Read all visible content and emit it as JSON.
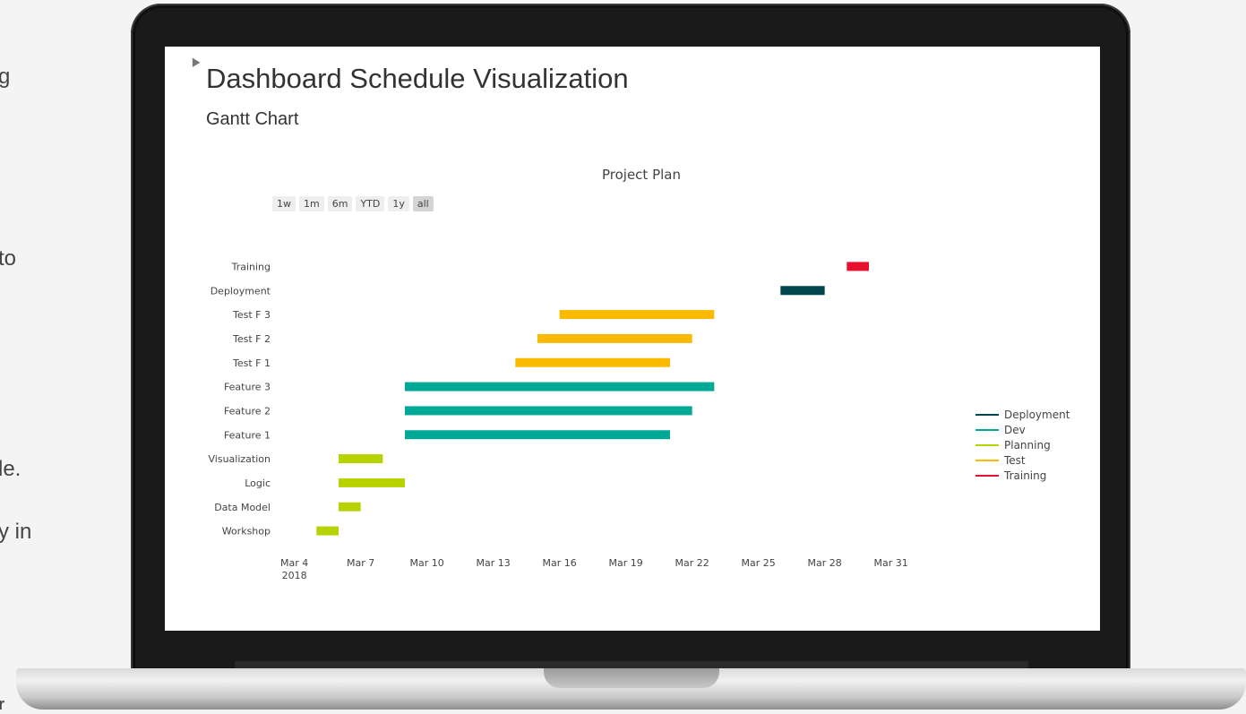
{
  "side_text": [
    "g",
    "to",
    "le.",
    "y in",
    "r"
  ],
  "page": {
    "title": "Dashboard Schedule Visualization",
    "subtitle": "Gantt Chart"
  },
  "range_buttons": [
    {
      "label": "1w",
      "active": false
    },
    {
      "label": "1m",
      "active": false
    },
    {
      "label": "6m",
      "active": false
    },
    {
      "label": "YTD",
      "active": false
    },
    {
      "label": "1y",
      "active": false
    },
    {
      "label": "all",
      "active": true
    }
  ],
  "colors": {
    "Deployment": "#00464e",
    "Dev": "#00a896",
    "Planning": "#b6d300",
    "Test": "#fbb900",
    "Training": "#e8112d"
  },
  "chart_data": {
    "type": "gantt",
    "title": "Project Plan",
    "x_axis": {
      "type": "date",
      "range": [
        "2018-03-03",
        "2018-04-02"
      ],
      "ticks": [
        {
          "date": "2018-03-04",
          "label": "Mar 4",
          "sublabel": "2018"
        },
        {
          "date": "2018-03-07",
          "label": "Mar 7"
        },
        {
          "date": "2018-03-10",
          "label": "Mar 10"
        },
        {
          "date": "2018-03-13",
          "label": "Mar 13"
        },
        {
          "date": "2018-03-16",
          "label": "Mar 16"
        },
        {
          "date": "2018-03-19",
          "label": "Mar 19"
        },
        {
          "date": "2018-03-22",
          "label": "Mar 22"
        },
        {
          "date": "2018-03-25",
          "label": "Mar 25"
        },
        {
          "date": "2018-03-28",
          "label": "Mar 28"
        },
        {
          "date": "2018-03-31",
          "label": "Mar 31"
        }
      ]
    },
    "tasks": [
      {
        "name": "Training",
        "start": "2018-03-29",
        "end": "2018-03-30",
        "group": "Training"
      },
      {
        "name": "Deployment",
        "start": "2018-03-26",
        "end": "2018-03-28",
        "group": "Deployment"
      },
      {
        "name": "Test F 3",
        "start": "2018-03-16",
        "end": "2018-03-23",
        "group": "Test"
      },
      {
        "name": "Test F 2",
        "start": "2018-03-15",
        "end": "2018-03-22",
        "group": "Test"
      },
      {
        "name": "Test F 1",
        "start": "2018-03-14",
        "end": "2018-03-21",
        "group": "Test"
      },
      {
        "name": "Feature 3",
        "start": "2018-03-09",
        "end": "2018-03-23",
        "group": "Dev"
      },
      {
        "name": "Feature 2",
        "start": "2018-03-09",
        "end": "2018-03-22",
        "group": "Dev"
      },
      {
        "name": "Feature 1",
        "start": "2018-03-09",
        "end": "2018-03-21",
        "group": "Dev"
      },
      {
        "name": "Visualization",
        "start": "2018-03-06",
        "end": "2018-03-08",
        "group": "Planning"
      },
      {
        "name": "Logic",
        "start": "2018-03-06",
        "end": "2018-03-09",
        "group": "Planning"
      },
      {
        "name": "Data Model",
        "start": "2018-03-06",
        "end": "2018-03-07",
        "group": "Planning"
      },
      {
        "name": "Workshop",
        "start": "2018-03-05",
        "end": "2018-03-06",
        "group": "Planning"
      }
    ],
    "legend": [
      "Deployment",
      "Dev",
      "Planning",
      "Test",
      "Training"
    ],
    "legend_position": "right",
    "grid": false
  }
}
